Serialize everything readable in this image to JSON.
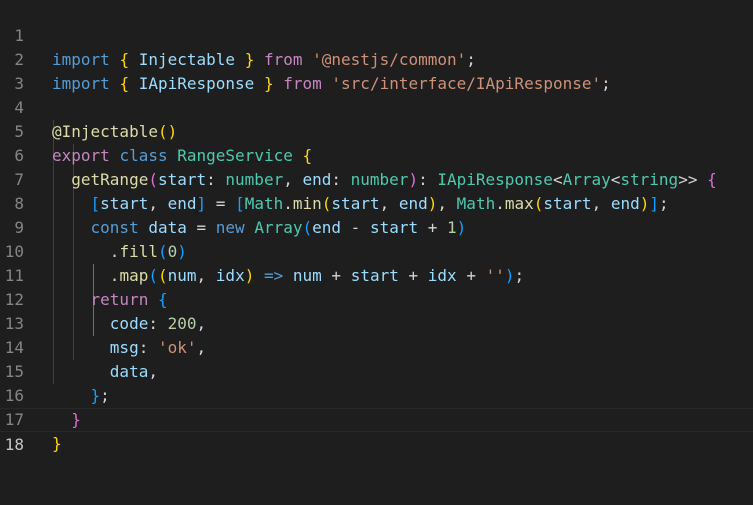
{
  "editor": {
    "language": "typescript",
    "line_numbers": [
      "1",
      "2",
      "3",
      "4",
      "5",
      "6",
      "7",
      "8",
      "9",
      "10",
      "11",
      "12",
      "13",
      "14",
      "15",
      "16",
      "17",
      "18"
    ],
    "current_line": 18
  },
  "tokens": {
    "import": "import",
    "from": "from",
    "export": "export",
    "class": "class",
    "const": "const",
    "new": "new",
    "return": "return",
    "injectable": "Injectable",
    "iapiresponse": "IApiResponse",
    "str_nest": "'@nestjs/common'",
    "str_iface": "'src/interface/IApiResponse'",
    "decorator": "@Injectable",
    "range_service": "RangeService",
    "get_range": "getRange",
    "start": "start",
    "end": "end",
    "number": "number",
    "array": "Array",
    "string": "string",
    "math": "Math",
    "min": "min",
    "max": "max",
    "data": "data",
    "fill": "fill",
    "map": "map",
    "num": "num",
    "idx": "idx",
    "one": "1",
    "zero": "0",
    "empty_str": "''",
    "code": "code",
    "code_val": "200",
    "msg": "msg",
    "ok": "'ok'"
  }
}
